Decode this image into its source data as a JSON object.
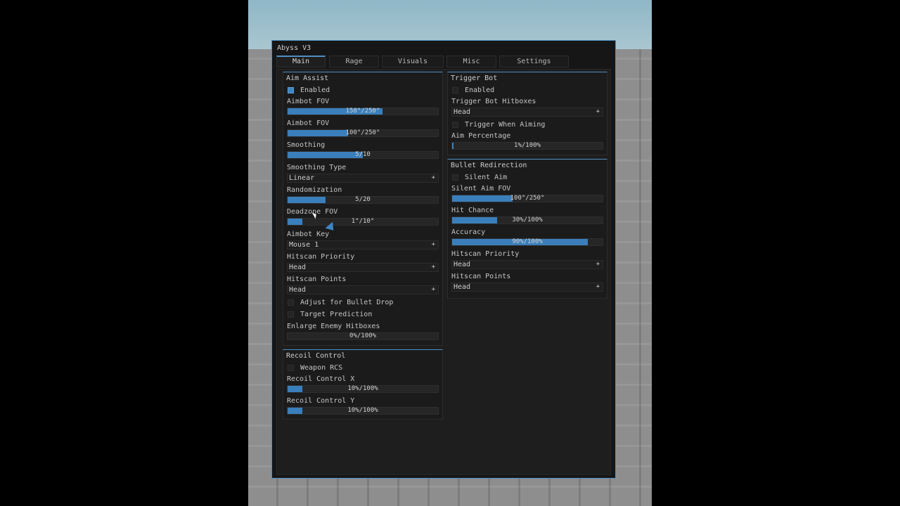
{
  "window": {
    "title": "Abyss V3"
  },
  "tabs": [
    "Main",
    "Rage",
    "Visuals",
    "Misc",
    "Settings"
  ],
  "active_tab": "Main",
  "accent_color": "#3d84c2",
  "aim_assist": {
    "title": "Aim Assist",
    "enabled": {
      "label": "Enabled",
      "checked": true
    },
    "aimbot_fov_1": {
      "label": "Aimbot FOV",
      "value_text": "158°/250°",
      "fraction": 0.63
    },
    "aimbot_fov_2": {
      "label": "Aimbot FOV",
      "value_text": "100°/250°",
      "fraction": 0.4
    },
    "smoothing": {
      "label": "Smoothing",
      "value_text": "5/10",
      "fraction": 0.5
    },
    "smoothing_type": {
      "label": "Smoothing Type",
      "value": "Linear"
    },
    "randomization": {
      "label": "Randomization",
      "value_text": "5/20",
      "fraction": 0.25
    },
    "deadzone_fov": {
      "label": "Deadzone FOV",
      "value_text": "1°/10°",
      "fraction": 0.1
    },
    "aimbot_key": {
      "label": "Aimbot Key",
      "value": "Mouse 1"
    },
    "hitscan_priority": {
      "label": "Hitscan Priority",
      "value": "Head"
    },
    "hitscan_points": {
      "label": "Hitscan Points",
      "value": "Head"
    },
    "adjust_bullet_drop": {
      "label": "Adjust for Bullet Drop",
      "checked": false
    },
    "target_prediction": {
      "label": "Target Prediction",
      "checked": false
    },
    "enlarge_hitboxes": {
      "label": "Enlarge Enemy Hitboxes",
      "value_text": "0%/100%",
      "fraction": 0.0
    }
  },
  "recoil_control": {
    "title": "Recoil Control",
    "weapon_rcs": {
      "label": "Weapon RCS",
      "checked": false
    },
    "recoil_x": {
      "label": "Recoil Control X",
      "value_text": "10%/100%",
      "fraction": 0.1
    },
    "recoil_y": {
      "label": "Recoil Control Y",
      "value_text": "10%/100%",
      "fraction": 0.1
    }
  },
  "trigger_bot": {
    "title": "Trigger Bot",
    "enabled": {
      "label": "Enabled",
      "checked": false
    },
    "hitboxes": {
      "label": "Trigger Bot Hitboxes",
      "value": "Head"
    },
    "when_aiming": {
      "label": "Trigger When Aiming",
      "checked": false
    },
    "aim_percentage": {
      "label": "Aim Percentage",
      "value_text": "1%/100%",
      "fraction": 0.01
    }
  },
  "bullet_redirection": {
    "title": "Bullet Redirection",
    "silent_aim": {
      "label": "Silent Aim",
      "checked": false
    },
    "silent_aim_fov": {
      "label": "Silent Aim FOV",
      "value_text": "100°/250°",
      "fraction": 0.4
    },
    "hit_chance": {
      "label": "Hit Chance",
      "value_text": "30%/100%",
      "fraction": 0.3
    },
    "accuracy": {
      "label": "Accuracy",
      "value_text": "90%/100%",
      "fraction": 0.9
    },
    "hitscan_priority": {
      "label": "Hitscan Priority",
      "value": "Head"
    },
    "hitscan_points": {
      "label": "Hitscan Points",
      "value": "Head"
    }
  },
  "dropdown_arrow": "+"
}
